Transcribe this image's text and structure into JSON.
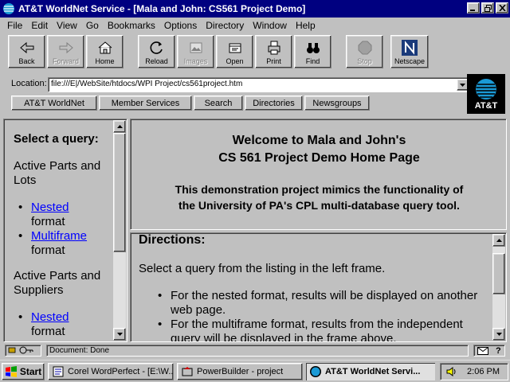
{
  "window": {
    "title": "AT&T WorldNet Service - [Mala and John: CS561 Project Demo]"
  },
  "menu": [
    "File",
    "Edit",
    "View",
    "Go",
    "Bookmarks",
    "Options",
    "Directory",
    "Window",
    "Help"
  ],
  "toolbar": {
    "back": "Back",
    "forward": "Forward",
    "home": "Home",
    "reload": "Reload",
    "images": "Images",
    "open": "Open",
    "print": "Print",
    "find": "Find",
    "stop": "Stop",
    "netscape": "Netscape"
  },
  "location": {
    "label": "Location:",
    "url": "file:///E|/WebSite/htdocs/WPI Project/cs561project.htm"
  },
  "directory_buttons": [
    "AT&T WorldNet",
    "Member Services",
    "Search",
    "Directories",
    "Newsgroups"
  ],
  "logo": {
    "text": "AT&T"
  },
  "left_frame": {
    "heading": "Select a query:",
    "groups": [
      {
        "title": "Active Parts and Lots",
        "items": [
          {
            "link": "Nested",
            "suffix": "format"
          },
          {
            "link": "Multiframe",
            "suffix": "format"
          }
        ]
      },
      {
        "title": "Active Parts and Suppliers",
        "items": [
          {
            "link": "Nested",
            "suffix": "format"
          }
        ]
      }
    ]
  },
  "top_frame": {
    "welcome_line1": "Welcome to Mala and John's",
    "welcome_line2": "CS 561 Project Demo Home Page",
    "desc_line1": "This demonstration project mimics the functionality of",
    "desc_line2": "the University of PA's CPL multi-database query tool."
  },
  "bottom_frame": {
    "title": "Directions:",
    "intro": "Select a query from the listing in the left frame.",
    "bullets": [
      "For the nested format, results will be displayed on another web page.",
      "For the multiframe format, results from the independent query will be displayed in the frame above."
    ]
  },
  "status": {
    "text": "Document: Done"
  },
  "taskbar": {
    "start": "Start",
    "tasks": [
      "Corel WordPerfect - [E:\\W...",
      "PowerBuilder - project",
      "AT&T WorldNet Servi..."
    ],
    "clock": "2:06 PM"
  },
  "colors": {
    "title_bar": "#000080",
    "face": "#c0c0c0",
    "link": "#0000ff"
  }
}
